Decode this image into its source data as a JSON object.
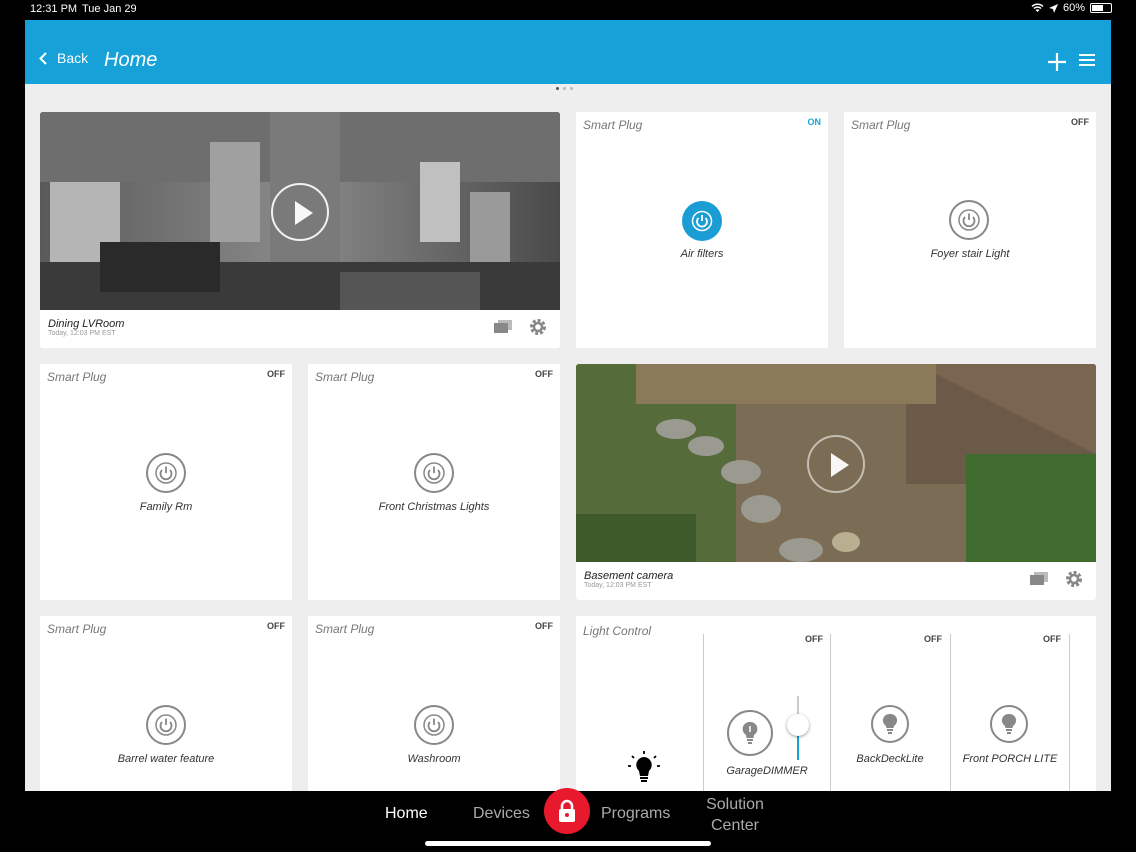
{
  "status": {
    "time": "12:31 PM",
    "date": "Tue Jan 29",
    "battery": "60%",
    "battery_level": 0.6
  },
  "header": {
    "back_label": "Back",
    "title": "Home"
  },
  "cameras": [
    {
      "name": "Dining LVRoom",
      "time": "Today, 12:03 PM EST"
    },
    {
      "name": "Basement camera",
      "time": "Today, 12:03 PM EST"
    }
  ],
  "plugs": [
    {
      "type": "Smart Plug",
      "state": "ON",
      "label": "Air filters"
    },
    {
      "type": "Smart Plug",
      "state": "OFF",
      "label": "Foyer stair Light"
    },
    {
      "type": "Smart Plug",
      "state": "OFF",
      "label": "Family Rm"
    },
    {
      "type": "Smart Plug",
      "state": "OFF",
      "label": "Front Christmas Lights"
    },
    {
      "type": "Smart Plug",
      "state": "OFF",
      "label": "Barrel water feature"
    },
    {
      "type": "Smart Plug",
      "state": "OFF",
      "label": "Washroom"
    }
  ],
  "light_control": {
    "title": "Light Control",
    "lights": [
      {
        "state": "OFF",
        "label": "GarageDIMMER",
        "dim_level": 0.45
      },
      {
        "state": "OFF",
        "label": "BackDeckLite"
      },
      {
        "state": "OFF",
        "label": "Front PORCH LITE"
      }
    ]
  },
  "tabs": {
    "home": "Home",
    "devices": "Devices",
    "programs": "Programs",
    "solution": "Solution Center"
  },
  "colors": {
    "accent": "#16a2d8",
    "lock": "#e8192c"
  }
}
